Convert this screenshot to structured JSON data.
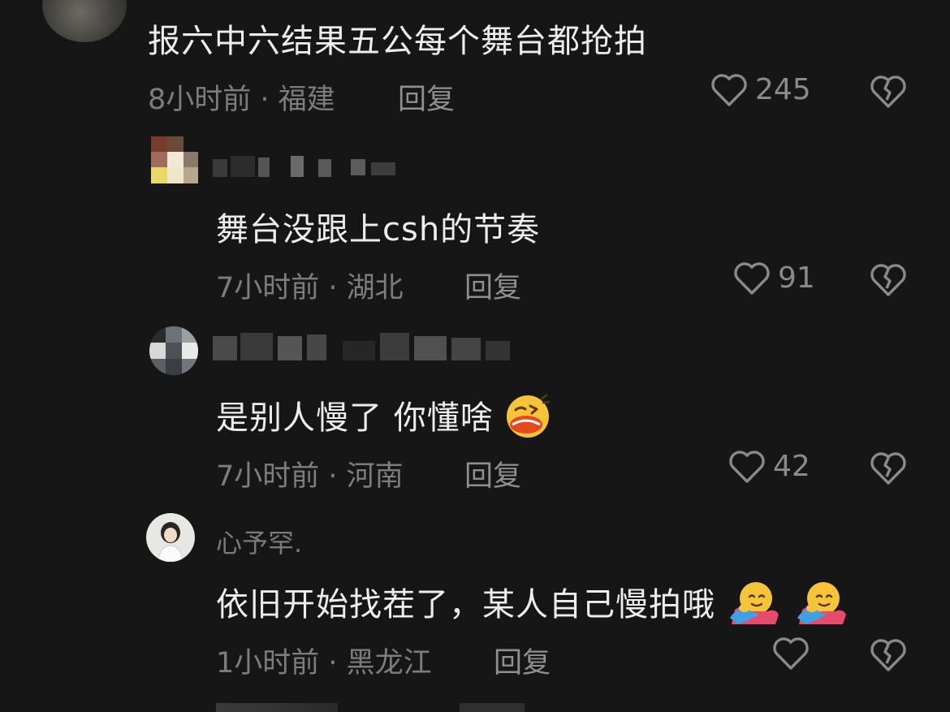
{
  "comments": [
    {
      "text": "报六中六结果五公每个舞台都抢拍",
      "meta": "8小时前 · 福建",
      "reply": "回复",
      "likes": "245"
    },
    {
      "text": "舞台没跟上csh的节奏",
      "meta": "7小时前 · 湖北",
      "reply": "回复",
      "likes": "91"
    },
    {
      "text": "是别人慢了 你懂啥",
      "meta": "7小时前 · 河南",
      "reply": "回复",
      "likes": "42"
    },
    {
      "username": "心予罕.",
      "text": "依旧开始找茬了，某人自己慢拍哦",
      "meta": "1小时前 · 黑龙江",
      "reply": "回复",
      "likes": ""
    }
  ],
  "colors": {
    "background": "#161616",
    "text": "#ececec",
    "muted": "#7d7d7d"
  },
  "icons": [
    "heart-icon",
    "broken-heart-icon",
    "grin-emoji",
    "hug-emoji"
  ]
}
